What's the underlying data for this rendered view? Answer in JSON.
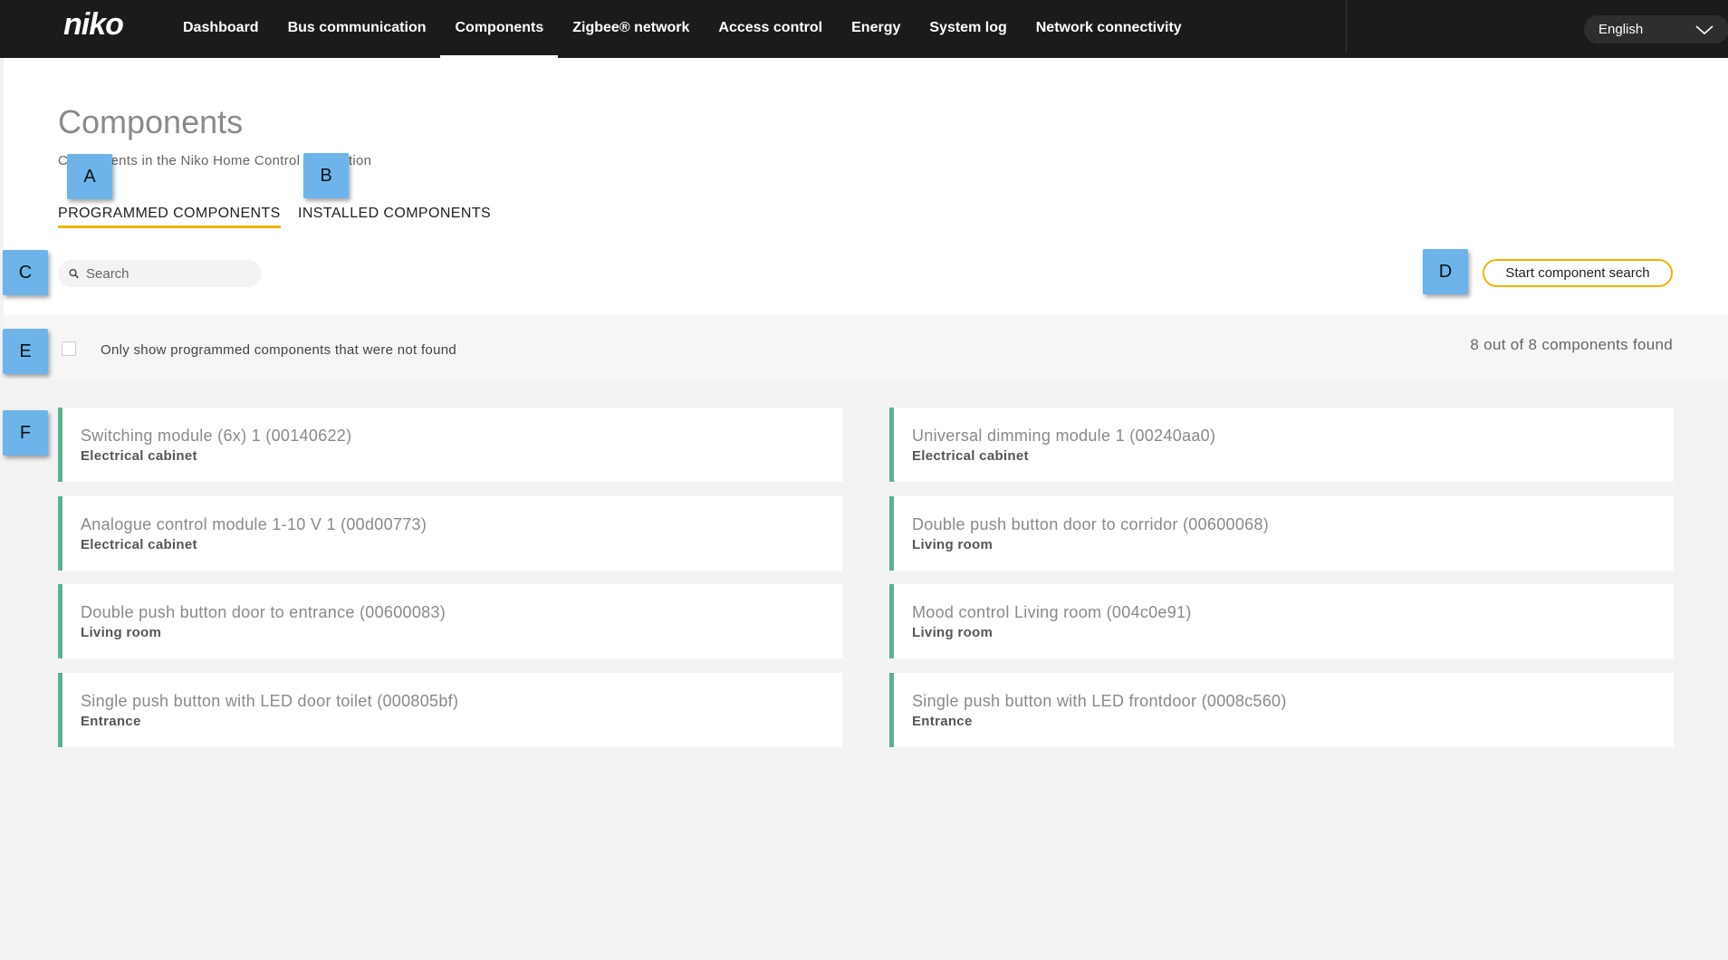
{
  "header": {
    "logo": "niko",
    "nav": [
      {
        "label": "Dashboard"
      },
      {
        "label": "Bus communication"
      },
      {
        "label": "Components"
      },
      {
        "label": "Zigbee® network"
      },
      {
        "label": "Access control"
      },
      {
        "label": "Energy"
      },
      {
        "label": "System log"
      },
      {
        "label": "Network connectivity"
      }
    ],
    "active_nav": "Components",
    "language": "English"
  },
  "page": {
    "title": "Components",
    "subtitle": "Components in the Niko Home Control installation",
    "tabs": [
      {
        "label": "PROGRAMMED COMPONENTS"
      },
      {
        "label": "INSTALLED COMPONENTS"
      }
    ],
    "active_tab": "PROGRAMMED COMPONENTS",
    "search": {
      "placeholder": "Search",
      "value": ""
    },
    "search_button": "Start component search",
    "filter_label": "Only show programmed components that were not found",
    "filter_checked": false,
    "count_text": "8 out of 8 components found"
  },
  "components": [
    {
      "name": "Switching module (6x) 1 (00140622)",
      "location": "Electrical cabinet"
    },
    {
      "name": "Universal dimming module 1 (00240aa0)",
      "location": "Electrical cabinet"
    },
    {
      "name": "Analogue control module 1-10 V 1 (00d00773)",
      "location": "Electrical cabinet"
    },
    {
      "name": "Double push button door to corridor (00600068)",
      "location": "Living room"
    },
    {
      "name": "Double push button door to entrance (00600083)",
      "location": "Living room"
    },
    {
      "name": "Mood control Living room (004c0e91)",
      "location": "Living room"
    },
    {
      "name": "Single push button with LED door toilet (000805bf)",
      "location": "Entrance"
    },
    {
      "name": "Single push button with LED frontdoor (0008c560)",
      "location": "Entrance"
    }
  ],
  "markers": [
    {
      "label": "A"
    },
    {
      "label": "B"
    },
    {
      "label": "C"
    },
    {
      "label": "D"
    },
    {
      "label": "E"
    },
    {
      "label": "F"
    }
  ],
  "colors": {
    "topbar": "#1b1b1b",
    "accent": "#f2b400",
    "card_border": "#5ab38d",
    "marker": "#6cb4ea"
  }
}
